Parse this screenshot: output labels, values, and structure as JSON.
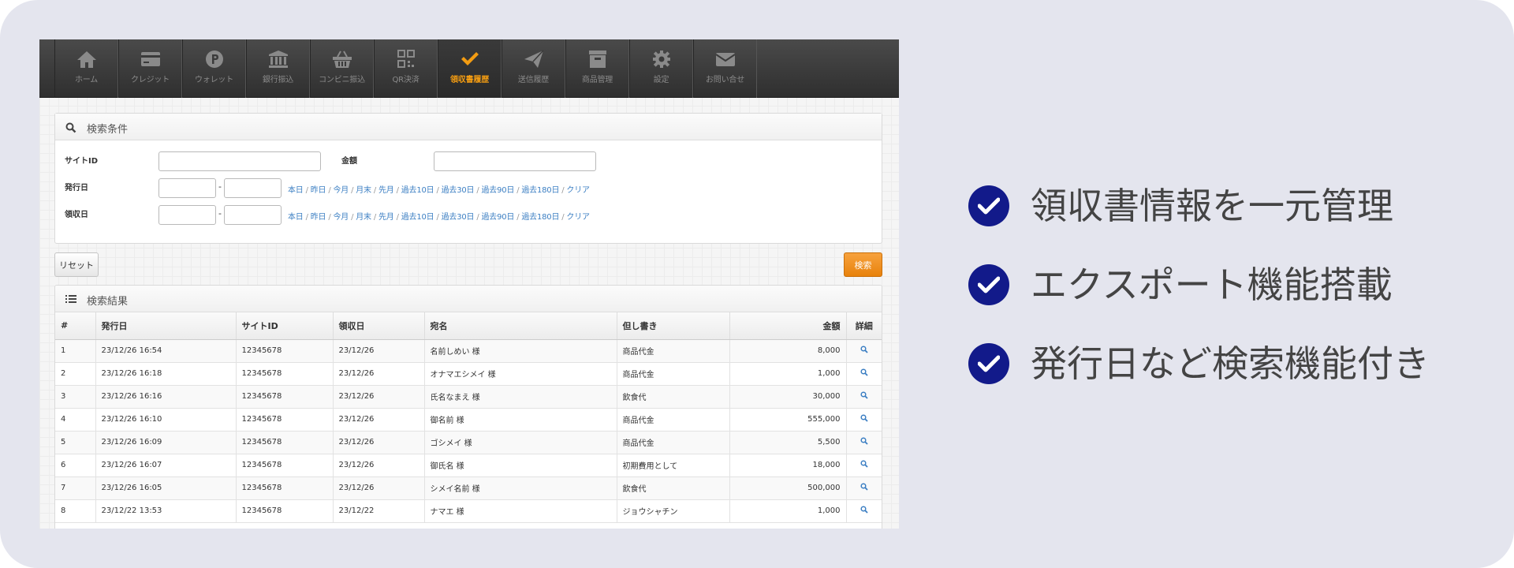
{
  "nav": {
    "items": [
      {
        "label": "ホーム",
        "icon": "home-icon"
      },
      {
        "label": "クレジット",
        "icon": "credit-card-icon"
      },
      {
        "label": "ウォレット",
        "icon": "wallet-p-icon"
      },
      {
        "label": "銀行振込",
        "icon": "bank-icon"
      },
      {
        "label": "コンビニ振込",
        "icon": "basket-icon"
      },
      {
        "label": "QR決済",
        "icon": "qr-code-icon"
      },
      {
        "label": "領収書履歴",
        "icon": "check-icon"
      },
      {
        "label": "送信履歴",
        "icon": "send-icon"
      },
      {
        "label": "商品管理",
        "icon": "archive-icon"
      },
      {
        "label": "設定",
        "icon": "gear-icon"
      },
      {
        "label": "お問い合せ",
        "icon": "envelope-icon"
      }
    ],
    "active_index": 6,
    "active_color": "#f39c12"
  },
  "search": {
    "title": "検索条件",
    "site_id_label": "サイトID",
    "amount_label": "金額",
    "issue_date_label": "発行日",
    "receipt_date_label": "領収日",
    "dash": "-",
    "date_links": [
      "本日",
      "昨日",
      "今月",
      "月末",
      "先月",
      "過去10日",
      "過去30日",
      "過去90日",
      "過去180日",
      "クリア"
    ],
    "separator": " / "
  },
  "buttons": {
    "reset": "リセット",
    "search": "検索"
  },
  "results": {
    "title": "検索結果",
    "columns": [
      "#",
      "発行日",
      "サイトID",
      "領収日",
      "宛名",
      "但し書き",
      "金額",
      "詳細"
    ],
    "rows": [
      [
        "1",
        "23/12/26 16:54",
        "12345678",
        "23/12/26",
        "名前しめい 様",
        "商品代金",
        "8,000"
      ],
      [
        "2",
        "23/12/26 16:18",
        "12345678",
        "23/12/26",
        "オナマエシメイ 様",
        "商品代金",
        "1,000"
      ],
      [
        "3",
        "23/12/26 16:16",
        "12345678",
        "23/12/26",
        "氏名なまえ 様",
        "飲食代",
        "30,000"
      ],
      [
        "4",
        "23/12/26 16:10",
        "12345678",
        "23/12/26",
        "御名前 様",
        "商品代金",
        "555,000"
      ],
      [
        "5",
        "23/12/26 16:09",
        "12345678",
        "23/12/26",
        "ゴシメイ 様",
        "商品代金",
        "5,500"
      ],
      [
        "6",
        "23/12/26 16:07",
        "12345678",
        "23/12/26",
        "御氏名 様",
        "初期費用として",
        "18,000"
      ],
      [
        "7",
        "23/12/26 16:05",
        "12345678",
        "23/12/26",
        "シメイ名前 様",
        "飲食代",
        "500,000"
      ],
      [
        "8",
        "23/12/22 13:53",
        "12345678",
        "23/12/22",
        "ナマエ 様",
        "ジョウシャチン",
        "1,000"
      ]
    ]
  },
  "features": [
    "領収書情報を一元管理",
    "エクスポート機能搭載",
    "発行日など検索機能付き"
  ],
  "colors": {
    "check_circle": "#121a8a",
    "search_button": "#e8820c",
    "link": "#3c7fc3"
  }
}
